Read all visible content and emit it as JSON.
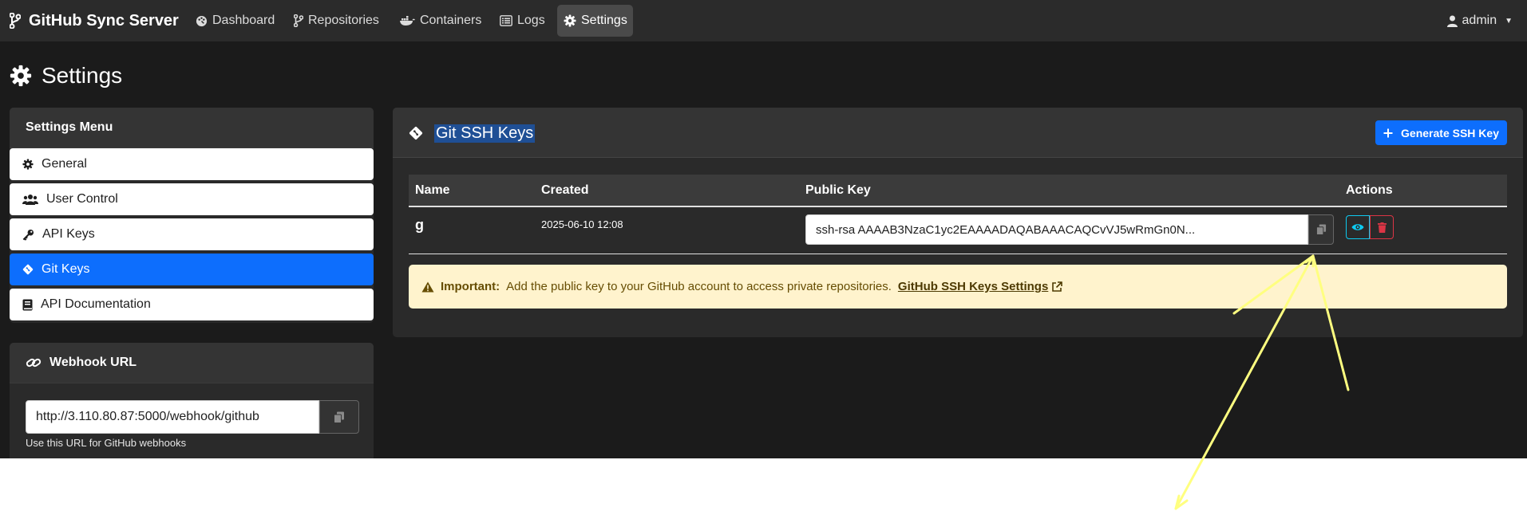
{
  "navbar": {
    "brand": "GitHub Sync Server",
    "links": [
      {
        "label": "Dashboard",
        "icon": "palette-icon"
      },
      {
        "label": "Repositories",
        "icon": "branch-icon"
      },
      {
        "label": "Containers",
        "icon": "docker-icon"
      },
      {
        "label": "Logs",
        "icon": "list-icon"
      },
      {
        "label": "Settings",
        "icon": "gear-icon",
        "active": true
      }
    ],
    "user": "admin"
  },
  "page": {
    "title": "Settings"
  },
  "settings_menu": {
    "header": "Settings Menu",
    "items": [
      {
        "label": "General",
        "icon": "gear-icon"
      },
      {
        "label": "User Control",
        "icon": "users-icon"
      },
      {
        "label": "API Keys",
        "icon": "key-icon"
      },
      {
        "label": "Git Keys",
        "icon": "git-icon",
        "active": true
      },
      {
        "label": "API Documentation",
        "icon": "book-icon"
      }
    ]
  },
  "webhook": {
    "header": "Webhook URL",
    "url": "http://3.110.80.87:5000/webhook/github",
    "help": "Use this URL for GitHub webhooks"
  },
  "ssh_keys": {
    "title": "Git SSH Keys",
    "generate_label": "Generate SSH Key",
    "columns": [
      "Name",
      "Created",
      "Public Key",
      "Actions"
    ],
    "rows": [
      {
        "name": "g",
        "created": "2025-06-10 12:08",
        "public_key": "ssh-rsa AAAAB3NzaC1yc2EAAAADAQABAAACAQCvVJ5wRmGn0N..."
      }
    ],
    "alert": {
      "strong": "Important:",
      "text": "Add the public key to your GitHub account to access private repositories.",
      "link": "GitHub SSH Keys Settings"
    }
  },
  "colors": {
    "primary": "#0d6efd",
    "danger": "#dc3545",
    "info": "#0dcaf0",
    "warning_bg": "#fff3cd",
    "annotation": "#ffff80"
  }
}
